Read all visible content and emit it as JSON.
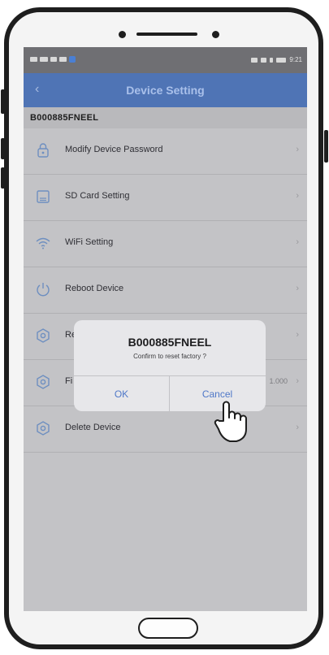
{
  "status_bar": {
    "time": "9:21"
  },
  "header": {
    "title": "Device Setting",
    "back_icon": "chevron-left-icon"
  },
  "device": {
    "id": "B000885FNEEL"
  },
  "menu": {
    "items": [
      {
        "label": "Modify Device Password",
        "icon": "lock-icon",
        "value": ""
      },
      {
        "label": "SD Card Setting",
        "icon": "sd-card-icon",
        "value": ""
      },
      {
        "label": "WiFi Setting",
        "icon": "wifi-icon",
        "value": ""
      },
      {
        "label": "Reboot Device",
        "icon": "power-icon",
        "value": ""
      },
      {
        "label": "Re",
        "icon": "settings-icon",
        "value": ""
      },
      {
        "label": "Fi",
        "icon": "settings-icon",
        "value": "1.000"
      },
      {
        "label": "Delete Device",
        "icon": "settings-icon",
        "value": ""
      }
    ]
  },
  "dialog": {
    "title": "B000885FNEEL",
    "message": "Confirm to reset factory ?",
    "ok_label": "OK",
    "cancel_label": "Cancel"
  },
  "colors": {
    "title_bar": "#4f74b5",
    "accent": "#4f78c8",
    "background": "#c3c3c6"
  }
}
